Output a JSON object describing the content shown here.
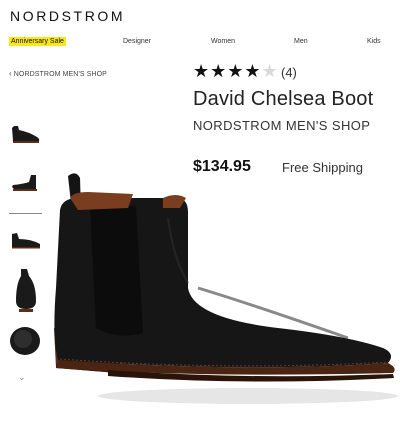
{
  "header": {
    "logo": "NORDSTROM"
  },
  "nav": {
    "anniversary": "Anniversary Sale",
    "designer": "Designer",
    "women": "Women",
    "men": "Men",
    "kids": "Kids"
  },
  "breadcrumb": {
    "label": "NORDSTROM MEN'S SHOP",
    "icon": "chevron-left-icon"
  },
  "product": {
    "rating_stars": "★★★★",
    "rating_off_star": "★",
    "rating_value": 4,
    "rating_count": "(4)",
    "title": "David Chelsea Boot",
    "brand": "NORDSTROM MEN'S SHOP",
    "price": "$134.95",
    "shipping": "Free Shipping"
  },
  "thumbnails": {
    "count": 5,
    "selected_index": 1,
    "more_icon": "chevron-down-icon"
  },
  "colors": {
    "highlight": "#f7e71b",
    "boot_leather": "#1a1a1a",
    "boot_lining": "#7a3d1f"
  }
}
